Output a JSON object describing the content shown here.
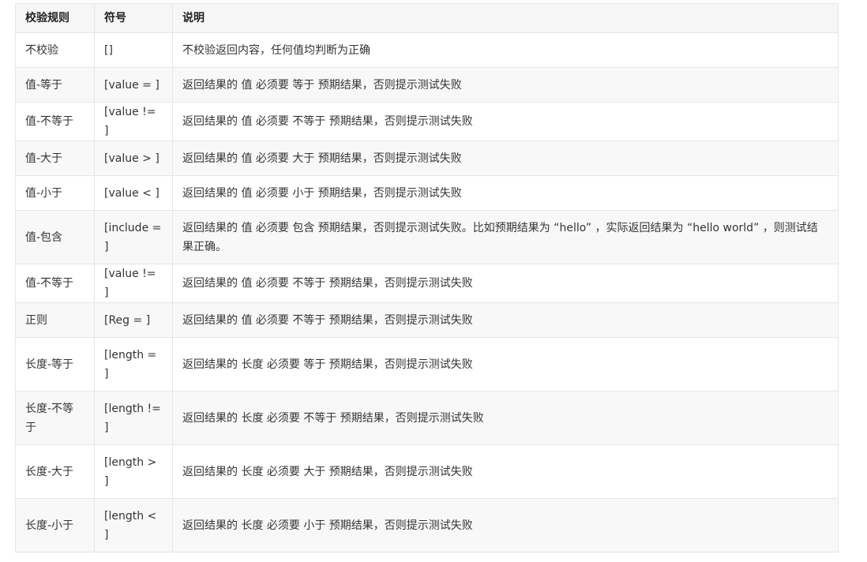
{
  "table": {
    "headers": [
      "校验规则",
      "符号",
      "说明"
    ],
    "rows": [
      {
        "rule": "不校验",
        "symbol": "[]",
        "desc": "不校验返回内容，任何值均判断为正确"
      },
      {
        "rule": "值-等于",
        "symbol": "[value = ]",
        "desc": "返回结果的 值 必须要 等于 预期结果，否则提示测试失败"
      },
      {
        "rule": "值-不等于",
        "symbol": "[value != ]",
        "desc": "返回结果的 值 必须要 不等于 预期结果，否则提示测试失败"
      },
      {
        "rule": "值-大于",
        "symbol": "[value > ]",
        "desc": "返回结果的 值 必须要 大于 预期结果，否则提示测试失败"
      },
      {
        "rule": "值-小于",
        "symbol": "[value < ]",
        "desc": "返回结果的 值 必须要 小于 预期结果，否则提示测试失败"
      },
      {
        "rule": "值-包含",
        "symbol": "[include = ]",
        "desc": "返回结果的 值 必须要 包含 预期结果，否则提示测试失败。比如预期结果为 “hello” ，实际返回结果为 “hello world” ，则测试结果正确。"
      },
      {
        "rule": "值-不等于",
        "symbol": "[value != ]",
        "desc": "返回结果的 值 必须要 不等于 预期结果，否则提示测试失败"
      },
      {
        "rule": "正则",
        "symbol": "[Reg = ]",
        "desc": "返回结果的 值 必须要 不等于 预期结果，否则提示测试失败"
      },
      {
        "rule": "长度-等于",
        "symbol": "[length = ]",
        "desc": "返回结果的 长度 必须要 等于 预期结果，否则提示测试失败"
      },
      {
        "rule": "长度-不等于",
        "symbol": "[length != ]",
        "desc": "返回结果的 长度 必须要 不等于 预期结果，否则提示测试失败"
      },
      {
        "rule": "长度-大于",
        "symbol": "[length > ]",
        "desc": "返回结果的 长度 必须要 大于 预期结果，否则提示测试失败"
      },
      {
        "rule": "长度-小于",
        "symbol": "[length < ]",
        "desc": "返回结果的 长度 必须要 小于 预期结果，否则提示测试失败"
      }
    ]
  }
}
